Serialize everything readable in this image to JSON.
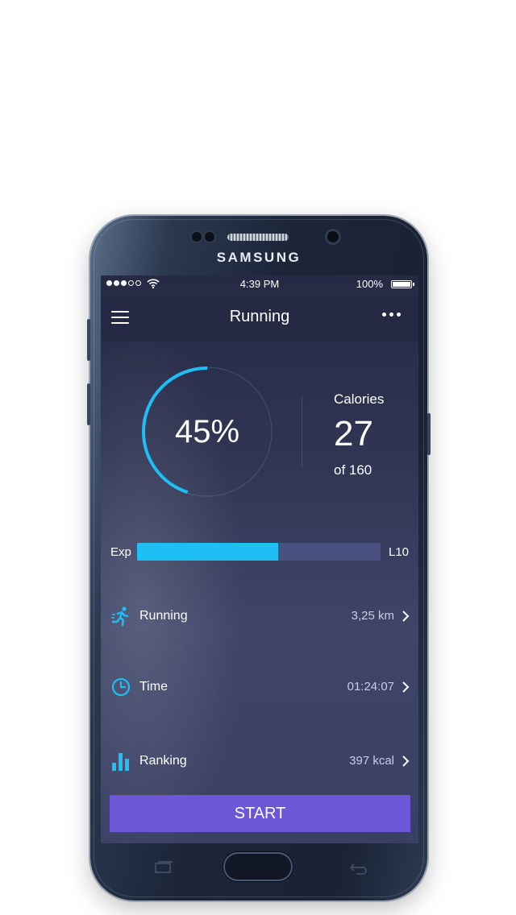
{
  "device": {
    "brand": "SAMSUNG"
  },
  "status_bar": {
    "time": "4:39 PM",
    "battery": "100%",
    "signal_bars_filled": 3,
    "signal_bars_total": 5
  },
  "nav": {
    "title": "Running",
    "menu_icon": "hamburger-icon",
    "more_icon": "more-dots-icon"
  },
  "progress": {
    "percent_label": "45%",
    "value": 0.45,
    "ring_color": "#1ebff5"
  },
  "calories": {
    "label": "Calories",
    "value": "27",
    "of_label": "of 160"
  },
  "exp": {
    "label": "Exp",
    "level": "L10",
    "fill": 0.58,
    "fill_color": "#1ebff5"
  },
  "stats": [
    {
      "icon": "runner-icon",
      "label": "Running",
      "value": "3,25 km"
    },
    {
      "icon": "clock-icon",
      "label": "Time",
      "value": "01:24:07"
    },
    {
      "icon": "bar-chart-icon",
      "label": "Ranking",
      "value": "397 kcal"
    }
  ],
  "start_button": {
    "label": "START",
    "color": "#6c57d9"
  },
  "accent_color": "#1ebff5"
}
